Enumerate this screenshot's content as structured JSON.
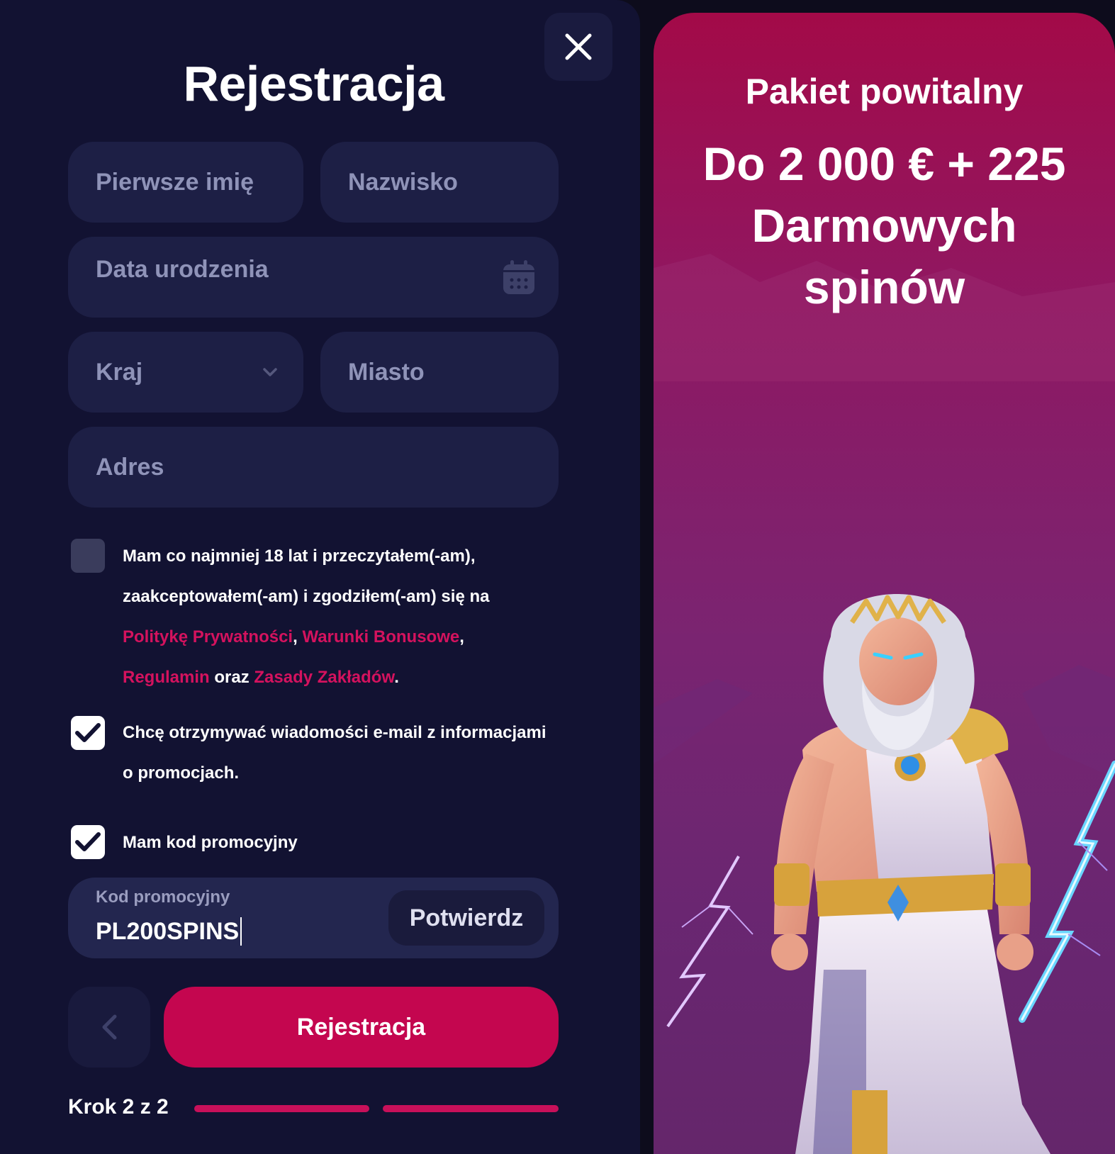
{
  "form": {
    "title": "Rejestracja",
    "first_name_placeholder": "Pierwsze imię",
    "last_name_placeholder": "Nazwisko",
    "birth_date_placeholder": "Data urodzenia",
    "country_placeholder": "Kraj",
    "city_placeholder": "Miasto",
    "address_placeholder": "Adres"
  },
  "consent": {
    "checked": false,
    "line1": "Mam co najmniej 18 lat i przeczytałem(-am),",
    "line2": "zaakceptowałem(-am) i zgodziłem(-am) się na",
    "privacy_link": "Politykę Prywatności",
    "sep1": ",",
    "bonus_link": "Warunki Bonusowe",
    "sep2": ",",
    "terms_link": "Regulamin",
    "and_word": "oraz",
    "betting_link": "Zasady Zakładów",
    "end": "."
  },
  "newsletter": {
    "checked": true,
    "line1": "Chcę otrzymywać wiadomości e-mail z informacjami",
    "line2": "o promocjach."
  },
  "promo_toggle": {
    "checked": true,
    "label": "Mam kod promocyjny"
  },
  "promo_code": {
    "label": "Kod promocyjny",
    "value": "PL200SPINS",
    "confirm_label": "Potwierdz"
  },
  "actions": {
    "register_label": "Rejestracja"
  },
  "steps": {
    "label": "Krok 2 z 2",
    "current": 2,
    "total": 2
  },
  "promo_panel": {
    "title": "Pakiet powitalny",
    "headline_line1": "Do 2 000 € + 225",
    "headline_line2": "Darmowych",
    "headline_line3": "spinów"
  },
  "icons": {
    "close": "close-icon",
    "calendar": "calendar-icon",
    "chevron": "chevron-down-icon",
    "check": "check-icon",
    "back": "chevron-left-icon"
  },
  "colors": {
    "panel_bg": "#121232",
    "field_bg": "#1d1f45",
    "accent": "#c4064f",
    "link": "#d4125e"
  }
}
